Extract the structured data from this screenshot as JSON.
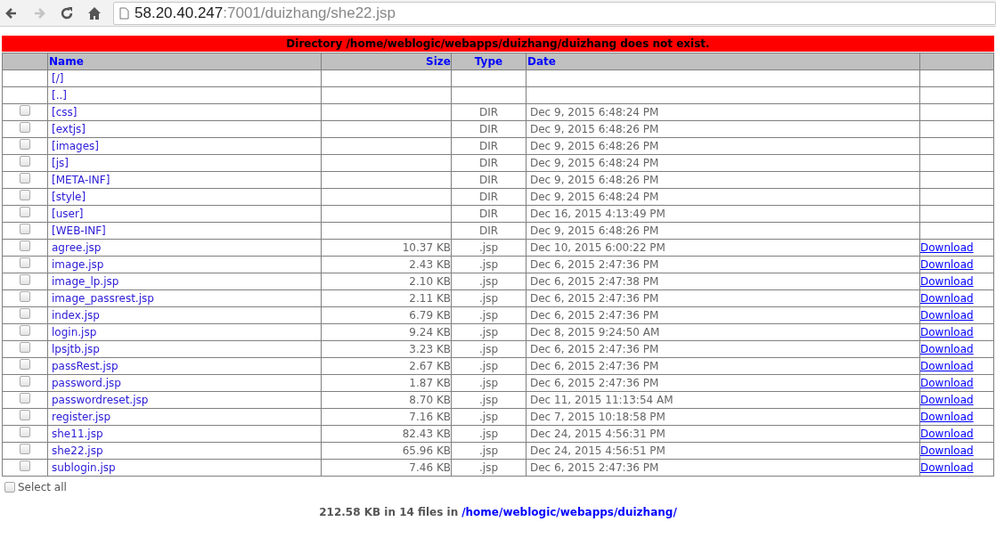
{
  "browser": {
    "nav_buttons": [
      {
        "kind": "back",
        "disabled": false
      },
      {
        "kind": "forward",
        "disabled": true
      },
      {
        "kind": "reload",
        "disabled": false
      },
      {
        "kind": "home",
        "disabled": false
      }
    ],
    "url_host": "58.20.40.247",
    "url_path": ":7001/duizhang/she22.jsp"
  },
  "error_banner": "Directory /home/weblogic/webapps/duizhang/duizhang does not exist.",
  "table": {
    "columns": [
      "Name",
      "Size",
      "Type",
      "Date"
    ],
    "rows": [
      {
        "kind": "nav",
        "name": "[/]"
      },
      {
        "kind": "nav",
        "name": "[..]"
      },
      {
        "kind": "dir",
        "checked": false,
        "name": "[css]",
        "type": "DIR",
        "date": "Dec 9, 2015 6:48:24 PM"
      },
      {
        "kind": "dir",
        "checked": false,
        "name": "[extjs]",
        "type": "DIR",
        "date": "Dec 9, 2015 6:48:26 PM"
      },
      {
        "kind": "dir",
        "checked": false,
        "name": "[images]",
        "type": "DIR",
        "date": "Dec 9, 2015 6:48:26 PM"
      },
      {
        "kind": "dir",
        "checked": false,
        "name": "[js]",
        "type": "DIR",
        "date": "Dec 9, 2015 6:48:24 PM"
      },
      {
        "kind": "dir",
        "checked": false,
        "name": "[META-INF]",
        "type": "DIR",
        "date": "Dec 9, 2015 6:48:26 PM"
      },
      {
        "kind": "dir",
        "checked": false,
        "name": "[style]",
        "type": "DIR",
        "date": "Dec 9, 2015 6:48:24 PM"
      },
      {
        "kind": "dir",
        "checked": false,
        "name": "[user]",
        "type": "DIR",
        "date": "Dec 16, 2015 4:13:49 PM"
      },
      {
        "kind": "dir",
        "checked": false,
        "name": "[WEB-INF]",
        "type": "DIR",
        "date": "Dec 9, 2015 6:48:26 PM"
      },
      {
        "kind": "file",
        "checked": false,
        "name": "agree.jsp",
        "size": "10.37 KB",
        "type": ".jsp",
        "date": "Dec 10, 2015 6:00:22 PM",
        "action": "Download"
      },
      {
        "kind": "file",
        "checked": false,
        "name": "image.jsp",
        "size": "2.43 KB",
        "type": ".jsp",
        "date": "Dec 6, 2015 2:47:36 PM",
        "action": "Download"
      },
      {
        "kind": "file",
        "checked": false,
        "name": "image_lp.jsp",
        "size": "2.10 KB",
        "type": ".jsp",
        "date": "Dec 6, 2015 2:47:38 PM",
        "action": "Download"
      },
      {
        "kind": "file",
        "checked": false,
        "name": "image_passrest.jsp",
        "size": "2.11 KB",
        "type": ".jsp",
        "date": "Dec 6, 2015 2:47:36 PM",
        "action": "Download"
      },
      {
        "kind": "file",
        "checked": false,
        "name": "index.jsp",
        "size": "6.79 KB",
        "type": ".jsp",
        "date": "Dec 6, 2015 2:47:36 PM",
        "action": "Download"
      },
      {
        "kind": "file",
        "checked": false,
        "name": "login.jsp",
        "size": "9.24 KB",
        "type": ".jsp",
        "date": "Dec 8, 2015 9:24:50 AM",
        "action": "Download"
      },
      {
        "kind": "file",
        "checked": false,
        "name": "lpsjtb.jsp",
        "size": "3.23 KB",
        "type": ".jsp",
        "date": "Dec 6, 2015 2:47:36 PM",
        "action": "Download"
      },
      {
        "kind": "file",
        "checked": false,
        "name": "passRest.jsp",
        "size": "2.67 KB",
        "type": ".jsp",
        "date": "Dec 6, 2015 2:47:36 PM",
        "action": "Download"
      },
      {
        "kind": "file",
        "checked": false,
        "name": "password.jsp",
        "size": "1.87 KB",
        "type": ".jsp",
        "date": "Dec 6, 2015 2:47:36 PM",
        "action": "Download"
      },
      {
        "kind": "file",
        "checked": false,
        "name": "passwordreset.jsp",
        "size": "8.70 KB",
        "type": ".jsp",
        "date": "Dec 11, 2015 11:13:54 AM",
        "action": "Download"
      },
      {
        "kind": "file",
        "checked": false,
        "name": "register.jsp",
        "size": "7.16 KB",
        "type": ".jsp",
        "date": "Dec 7, 2015 10:18:58 PM",
        "action": "Download"
      },
      {
        "kind": "file",
        "checked": false,
        "name": "she11.jsp",
        "size": "82.43 KB",
        "type": ".jsp",
        "date": "Dec 24, 2015 4:56:31 PM",
        "action": "Download"
      },
      {
        "kind": "file",
        "checked": false,
        "name": "she22.jsp",
        "size": "65.96 KB",
        "type": ".jsp",
        "date": "Dec 24, 2015 4:56:51 PM",
        "action": "Download"
      },
      {
        "kind": "file",
        "checked": false,
        "name": "sublogin.jsp",
        "size": "7.46 KB",
        "type": ".jsp",
        "date": "Dec 6, 2015 2:47:36 PM",
        "action": "Download"
      }
    ]
  },
  "select_all": {
    "label": "Select all",
    "checked": false
  },
  "summary": {
    "text": "212.58 KB in 14 files in",
    "link": "/home/weblogic/webapps/duizhang/"
  }
}
